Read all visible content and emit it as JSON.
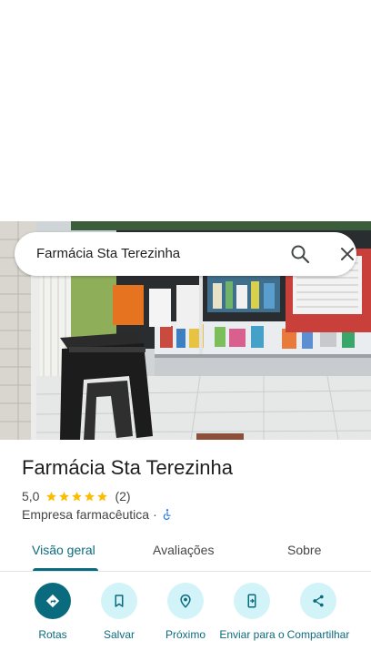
{
  "search": {
    "query": "Farmácia Sta Terezinha"
  },
  "place": {
    "name": "Farmácia Sta Terezinha",
    "rating": "5,0",
    "stars": 5,
    "review_count": "(2)",
    "category": "Empresa farmacêutica",
    "separator": "·"
  },
  "tabs": [
    {
      "label": "Visão geral",
      "active": true
    },
    {
      "label": "Avaliações",
      "active": false
    },
    {
      "label": "Sobre",
      "active": false
    }
  ],
  "actions": [
    {
      "label": "Rotas",
      "icon": "directions-icon"
    },
    {
      "label": "Salvar",
      "icon": "bookmark-icon"
    },
    {
      "label": "Próximo",
      "icon": "nearby-icon"
    },
    {
      "label": "Enviar para o",
      "icon": "send-to-phone-icon"
    },
    {
      "label": "Compartilhar",
      "icon": "share-icon"
    }
  ],
  "colors": {
    "accent": "#0b6b7e",
    "accent_light": "#d2f4f9",
    "star": "#fbbc04",
    "accessibility": "#1a73e8"
  }
}
